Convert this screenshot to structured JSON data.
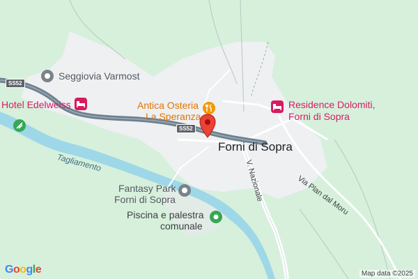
{
  "places": {
    "seggiovia": "Seggiovia Varmost",
    "hotel": "Hotel Edelweiss",
    "osteria_line1": "Antica Osteria",
    "osteria_line2": "La Speranza",
    "residence_line1": "Residence Dolomiti,",
    "residence_line2": "Forni di Sopra",
    "town": "Forni di Sopra",
    "fantasy_line1": "Fantasy Park",
    "fantasy_line2": "Forni di Sopra",
    "piscina_line1": "Piscina e palestra",
    "piscina_line2": "comunale"
  },
  "water": {
    "river": "Tagliamento"
  },
  "roads": {
    "shield_west": "SS52",
    "shield_center": "SS52",
    "v_nazionale": "V. Nazionale",
    "via_plan": "Via Plan dal Moru"
  },
  "footer": {
    "brand_letters": [
      "G",
      "o",
      "o",
      "g",
      "l",
      "e"
    ],
    "attribution": "Map data ©2025"
  },
  "colors": {
    "land": "#d6f0dc",
    "urban": "#eef0f2",
    "water": "#9ed8e8",
    "highway": "#6d7f8c",
    "road": "#ffffff",
    "marker": "#ea4335",
    "pink": "#d81b60",
    "orange": "#e37400",
    "green": "#34a853"
  }
}
